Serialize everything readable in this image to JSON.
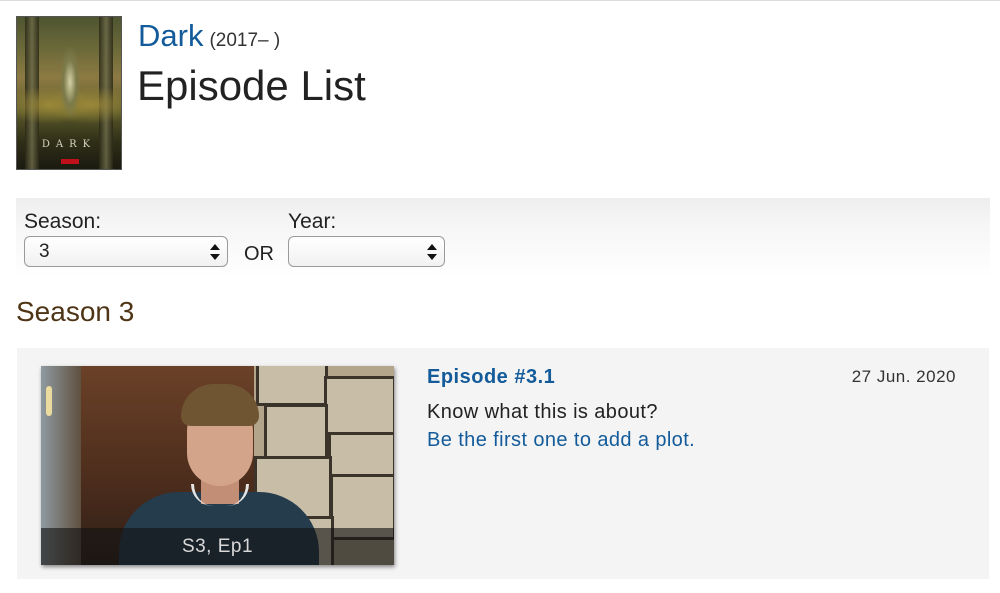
{
  "show": {
    "title": "Dark",
    "years": "(2017– )",
    "poster_text": "DARK"
  },
  "page": {
    "title": "Episode List"
  },
  "filters": {
    "season_label": "Season:",
    "season_value": "3",
    "or_label": "OR",
    "year_label": "Year:",
    "year_value": ""
  },
  "season_heading": "Season 3",
  "episodes": [
    {
      "title": "Episode #3.1",
      "air_date": "27 Jun. 2020",
      "caption": "S3, Ep1",
      "plot_prompt": "Know what this is about?",
      "add_plot_link": "Be the first one to add a plot."
    }
  ],
  "colors": {
    "link": "#135b9a",
    "season_heading": "#4e3516",
    "card_background": "#f4f4f4",
    "poster_brand": "#c0111a"
  },
  "icons": {
    "select_arrows": "up-down-chevron-icon"
  }
}
